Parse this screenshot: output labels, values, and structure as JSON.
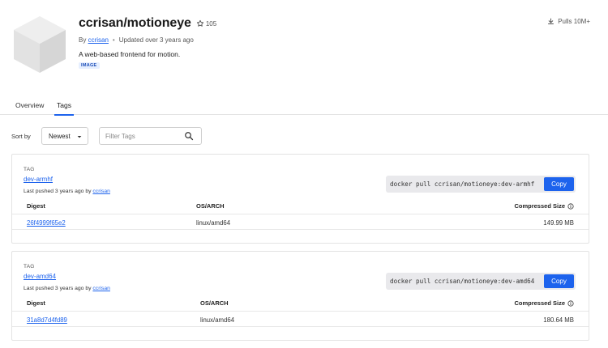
{
  "repo": {
    "name": "ccrisan/motioneye",
    "stars": "105",
    "by_prefix": "By",
    "author": "ccrisan",
    "updated": "Updated over 3 years ago",
    "description": "A web-based frontend for motion.",
    "badge": "IMAGE",
    "pulls": "Pulls 10M+"
  },
  "tabs": [
    {
      "label": "Overview"
    },
    {
      "label": "Tags",
      "active": true
    }
  ],
  "controls": {
    "sort_label": "Sort by",
    "sort_value": "Newest",
    "filter_placeholder": "Filter Tags"
  },
  "tags": [
    {
      "label": "TAG",
      "name": "dev-armhf",
      "pushed_prefix": "Last pushed 3 years ago by",
      "pushed_by": "ccrisan",
      "command": "docker pull ccrisan/motioneye:dev-armhf",
      "copy_label": "Copy",
      "columns": {
        "digest": "Digest",
        "os_arch": "OS/ARCH",
        "size": "Compressed Size"
      },
      "rows": [
        {
          "digest": "26f4999f65e2",
          "os_arch": "linux/amd64",
          "size": "149.99 MB"
        }
      ]
    },
    {
      "label": "TAG",
      "name": "dev-amd64",
      "pushed_prefix": "Last pushed 3 years ago by",
      "pushed_by": "ccrisan",
      "command": "docker pull ccrisan/motioneye:dev-amd64",
      "copy_label": "Copy",
      "columns": {
        "digest": "Digest",
        "os_arch": "OS/ARCH",
        "size": "Compressed Size"
      },
      "rows": [
        {
          "digest": "31a8d7d4fd89",
          "os_arch": "linux/amd64",
          "size": "180.64 MB"
        }
      ]
    }
  ],
  "colors": {
    "accent": "#1d63ed",
    "border": "#e3e3e3",
    "badge_bg": "#e6efff"
  },
  "icons": [
    "repo-cube-icon",
    "star-icon",
    "download-icon",
    "chevron-down-icon",
    "search-icon",
    "info-icon"
  ]
}
